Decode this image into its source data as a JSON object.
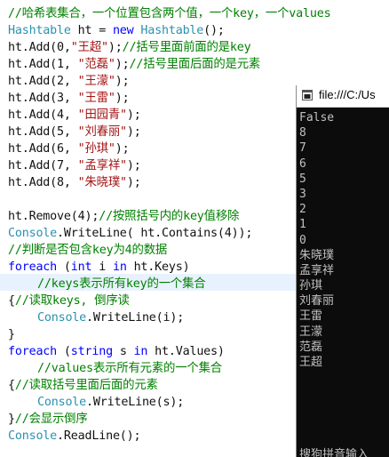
{
  "code": {
    "l1": {
      "comment": "//哈希表集合，一个位置包含两个值，一个key，一个values"
    },
    "l2": {
      "type": "Hashtable",
      "mid": " ht = ",
      "kw": "new",
      "type2": " Hashtable",
      "end": "();"
    },
    "l3": {
      "pre": "ht.Add(0,",
      "str": "\"王超\"",
      "post": ");",
      "comment": "//括号里面前面的是key"
    },
    "l4": {
      "pre": "ht.Add(1, ",
      "str": "\"范磊\"",
      "post": ");",
      "comment": "//括号里面后面的是元素"
    },
    "l5": {
      "pre": "ht.Add(2, ",
      "str": "\"王濛\"",
      "post": ");"
    },
    "l6": {
      "pre": "ht.Add(3, ",
      "str": "\"王雷\"",
      "post": ");"
    },
    "l7": {
      "pre": "ht.Add(4, ",
      "str": "\"田园青\"",
      "post": ");"
    },
    "l8": {
      "pre": "ht.Add(5, ",
      "str": "\"刘春丽\"",
      "post": ");"
    },
    "l9": {
      "pre": "ht.Add(6, ",
      "str": "\"孙琪\"",
      "post": ");"
    },
    "l10": {
      "pre": "ht.Add(7, ",
      "str": "\"孟享祥\"",
      "post": ");"
    },
    "l11": {
      "pre": "ht.Add(8, ",
      "str": "\"朱晓璞\"",
      "post": ");"
    },
    "l13": {
      "pre": "ht.Remove(4);",
      "comment": "//按照括号内的key值移除"
    },
    "l14": {
      "type": "Console",
      "post": ".WriteLine( ht.Contains(4));"
    },
    "l15": {
      "comment": "//判断是否包含key为4的数据"
    },
    "l16": {
      "kw": "foreach",
      "p1": " (",
      "kw2": "int",
      "p2": " i ",
      "kw3": "in",
      "p3": " ht.Keys)"
    },
    "l17": {
      "comment": "//keys表示所有key的一个集合"
    },
    "l18": {
      "pre": "{",
      "comment": "//读取keys, 倒序读"
    },
    "l19": {
      "type": "Console",
      "post": ".WriteLine(i);"
    },
    "l20": {
      "pre": "}"
    },
    "l21": {
      "kw": "foreach",
      "p1": " (",
      "kw2": "string",
      "p2": " s ",
      "kw3": "in",
      "p3": " ht.Values)"
    },
    "l22": {
      "comment": "//values表示所有元素的一个集合"
    },
    "l23": {
      "pre": "{",
      "comment": "//读取括号里面后面的元素"
    },
    "l24": {
      "type": "Console",
      "post": ".WriteLine(s);"
    },
    "l25": {
      "pre": "}",
      "comment": "//会显示倒序"
    },
    "l26": {
      "type": "Console",
      "post": ".ReadLine();"
    }
  },
  "console_window": {
    "title": "file:///C:/Us",
    "icon": "console-window-icon",
    "output": [
      "False",
      "8",
      "7",
      "6",
      "5",
      "3",
      "2",
      "1",
      "0",
      "朱晓璞",
      "孟享祥",
      "孙琪",
      "刘春丽",
      "王雷",
      "王濛",
      "范磊",
      "王超"
    ],
    "ime_text": "搜狗拼音输入"
  },
  "colors": {
    "keyword": "#0000ff",
    "type": "#2b91af",
    "string": "#a31515",
    "comment": "#008000",
    "console_bg": "#0c0c0c",
    "console_text": "#c0c0c0"
  }
}
